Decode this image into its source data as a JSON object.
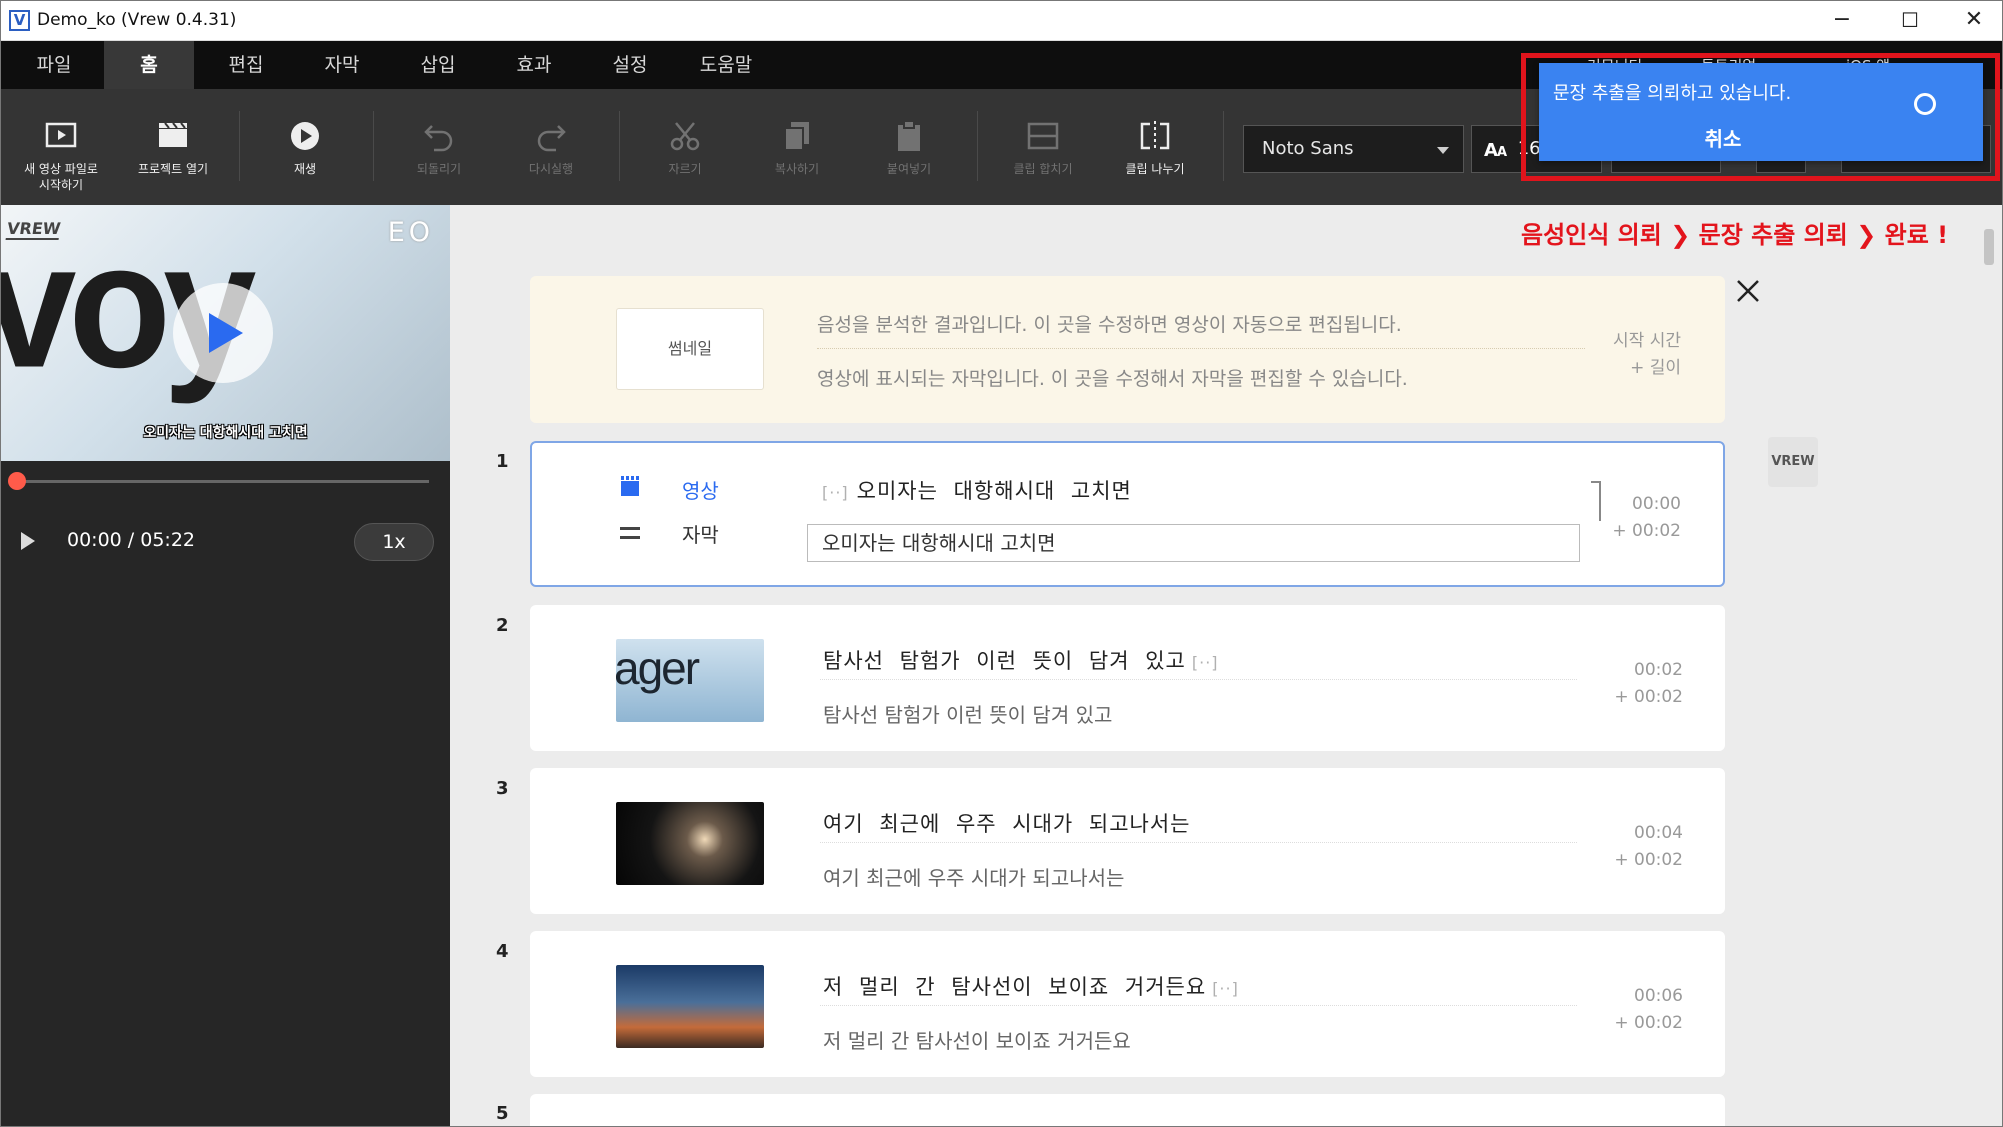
{
  "window": {
    "icon_letter": "V",
    "title": "Demo_ko (Vrew 0.4.31)",
    "minimize": "−",
    "maximize": "☐",
    "close": "✕"
  },
  "menu": {
    "tabs": [
      "파일",
      "홈",
      "편집",
      "자막",
      "삽입",
      "효과",
      "설정",
      "도움말"
    ],
    "active": "홈",
    "right_links": [
      "커뮤니티",
      "튜토리얼",
      "iOS 앱"
    ]
  },
  "toolbar": {
    "new_video": "새 영상 파일로\n시작하기",
    "open_project": "프로젝트 열기",
    "play": "재생",
    "undo": "되돌리기",
    "redo": "다시실행",
    "cut": "자르기",
    "copy": "복사하기",
    "paste": "붙여넣기",
    "merge_clip": "클립 합치기",
    "split_clip": "클립 나누기",
    "font_name": "Noto Sans",
    "font_size": "16"
  },
  "notification": {
    "message": "문장 추출을 의뢰하고 있습니다.",
    "cancel": "취소"
  },
  "status_flow": "음성인식 의뢰 ❯ 문장 추출 의뢰 ❯ 완료 !",
  "player": {
    "video_text": "voy",
    "video_tag": "VREW",
    "video_logo": "EO",
    "subtitle": "오미자는 대항해시대 고치면",
    "time": "00:00 / 05:22",
    "speed": "1x"
  },
  "header_card": {
    "thumbnail_label": "썸네일",
    "line1": "음성을 분석한 결과입니다. 이 곳을 수정하면 영상이 자동으로 편집됩니다.",
    "line2": "영상에 표시되는 자막입니다. 이 곳을 수정해서 자막을 편집할 수 있습니다.",
    "start_time": "시작 시간",
    "length": "+ 길이"
  },
  "segments": [
    {
      "num": "1",
      "video_label": "영상",
      "subtitle_label": "자막",
      "ellipsis": "[··]",
      "transcript": "오미자는 대항해시대 고치면",
      "subtitle": "오미자는 대항해시대 고치면",
      "start": "00:00",
      "length": "+ 00:02"
    },
    {
      "num": "2",
      "transcript": "탐사선 탐험가 이런 뜻이 담겨 있고",
      "ellipsis": "[··]",
      "subtitle": "탐사선 탐험가 이런 뜻이 담겨 있고",
      "start": "00:02",
      "length": "+ 00:02",
      "thumb_text": "ager"
    },
    {
      "num": "3",
      "transcript": "여기 최근에 우주 시대가 되고나서는",
      "subtitle": "여기 최근에 우주 시대가 되고나서는",
      "start": "00:04",
      "length": "+ 00:02"
    },
    {
      "num": "4",
      "transcript": "저 멀리 간 탐사선이 보이죠 거거든요",
      "ellipsis": "[··]",
      "subtitle": "저 멀리 간 탐사선이 보이죠 거거든요",
      "start": "00:06",
      "length": "+ 00:02"
    },
    {
      "num": "5"
    }
  ],
  "side_badge": "VREW",
  "colors": {
    "accent": "#2a6af0",
    "notification": "#3a83f1",
    "highlight": "#e0141c",
    "progress_knob": "#ff5b4a"
  }
}
